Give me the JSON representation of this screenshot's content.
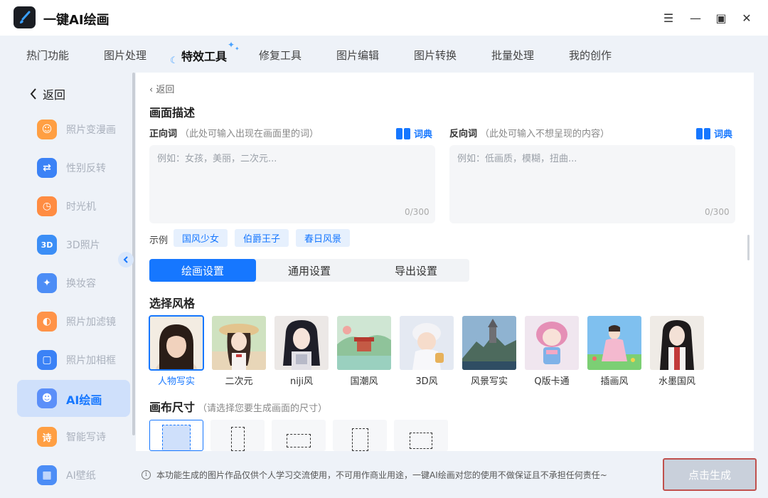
{
  "app": {
    "title": "一键AI绘画"
  },
  "window_controls": {
    "menu": "☰",
    "minimize": "—",
    "maximize": "▣",
    "close": "✕"
  },
  "topnav": {
    "items": [
      "热门功能",
      "图片处理",
      "特效工具",
      "修复工具",
      "图片编辑",
      "图片转换",
      "批量处理",
      "我的创作"
    ],
    "active": "特效工具"
  },
  "sidebar": {
    "back_label": "返回",
    "items": [
      {
        "label": "照片变漫画",
        "icon": "cartoon-face-icon",
        "color": "#ff9f43",
        "glyph": "☺"
      },
      {
        "label": "性别反转",
        "icon": "gender-swap-icon",
        "color": "#3b82f6",
        "glyph": "⇄"
      },
      {
        "label": "时光机",
        "icon": "time-machine-icon",
        "color": "#ff8c42",
        "glyph": "◷"
      },
      {
        "label": "3D照片",
        "icon": "3d-photo-icon",
        "color": "#3b8ef6",
        "glyph": "3D"
      },
      {
        "label": "换妆容",
        "icon": "makeup-icon",
        "color": "#4c8df6",
        "glyph": "✦"
      },
      {
        "label": "照片加滤镜",
        "icon": "filter-icon",
        "color": "#ff9348",
        "glyph": "◐"
      },
      {
        "label": "照片加相框",
        "icon": "frame-icon",
        "color": "#3b82f6",
        "glyph": "▢"
      },
      {
        "label": "AI绘画",
        "icon": "ai-paint-icon",
        "color": "#5b8ff9",
        "glyph": "☻"
      },
      {
        "label": "智能写诗",
        "icon": "poem-icon",
        "color": "#ff9f43",
        "glyph": "诗"
      },
      {
        "label": "AI壁纸",
        "icon": "wallpaper-icon",
        "color": "#4c8df6",
        "glyph": "▦"
      }
    ],
    "active": "AI绘画"
  },
  "main": {
    "back_label": "返回",
    "description_title": "画面描述",
    "positive": {
      "label": "正向词",
      "hint": "（此处可输入出现在画面里的词）",
      "placeholder": "例如：女孩，美丽，二次元...",
      "counter": "0/300",
      "dict_label": "词典"
    },
    "negative": {
      "label": "反向词",
      "hint": "（此处可输入不想呈现的内容）",
      "placeholder": "例如：低画质，模糊，扭曲...",
      "counter": "0/300",
      "dict_label": "词典"
    },
    "examples_label": "示例",
    "examples": [
      "国风少女",
      "伯爵王子",
      "春日风景"
    ],
    "tabs": [
      "绘画设置",
      "通用设置",
      "导出设置"
    ],
    "active_tab": "绘画设置",
    "style_title": "选择风格",
    "styles": [
      {
        "label": "人物写实",
        "selected": true
      },
      {
        "label": "二次元",
        "selected": false
      },
      {
        "label": "niji风",
        "selected": false
      },
      {
        "label": "国潮风",
        "selected": false
      },
      {
        "label": "3D风",
        "selected": false
      },
      {
        "label": "风景写实",
        "selected": false
      },
      {
        "label": "Q版卡通",
        "selected": false
      },
      {
        "label": "插画风",
        "selected": false
      },
      {
        "label": "水墨国风",
        "selected": false
      }
    ],
    "canvas_title": "画布尺寸",
    "canvas_hint": "（请选择您要生成画面的尺寸）"
  },
  "footer": {
    "notice": "本功能生成的图片作品仅供个人学习交流使用，不可用作商业用途，一键AI绘画对您的使用不做保证且不承担任何责任~",
    "generate_label": "点击生成"
  }
}
